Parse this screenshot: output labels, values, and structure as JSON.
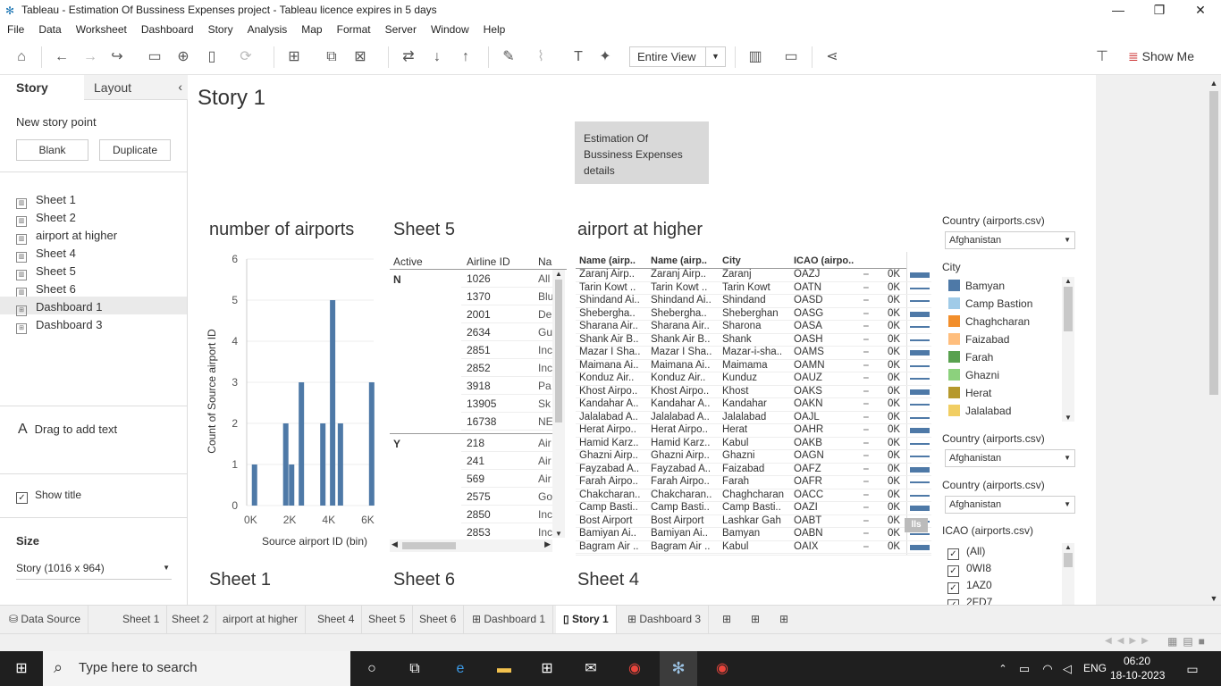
{
  "window": {
    "title": "Tableau - Estimation Of Bussiness Expenses  project - Tableau licence expires in 5 days"
  },
  "menu": [
    "File",
    "Data",
    "Worksheet",
    "Dashboard",
    "Story",
    "Analysis",
    "Map",
    "Format",
    "Server",
    "Window",
    "Help"
  ],
  "toolbar": {
    "view_select": "Entire View",
    "show_me": "Show Me"
  },
  "left": {
    "tab_story": "Story",
    "tab_layout": "Layout",
    "new_story_point": "New story point",
    "blank": "Blank",
    "duplicate": "Duplicate",
    "sheets": [
      "Sheet 1",
      "Sheet 2",
      "airport at higher",
      "Sheet 4",
      "Sheet 5",
      "Sheet 6",
      "Dashboard 1",
      "Dashboard 3"
    ],
    "drag_text": "Drag to add text",
    "show_title": "Show title",
    "size_label": "Size",
    "size_value": "Story (1016 x 964)"
  },
  "story": {
    "title": "Story 1",
    "caption": "Estimation Of Bussiness Expenses details",
    "sheet_titles": {
      "num_airports": "number of airports",
      "sheet5": "Sheet 5",
      "airport_higher": "airport at higher",
      "sheet1": "Sheet 1",
      "sheet6": "Sheet 6",
      "sheet4": "Sheet 4"
    }
  },
  "chart_data": {
    "type": "bar",
    "title": "number of airports",
    "xlabel": "Source airport ID (bin)",
    "ylabel": "Count of Source airport ID",
    "yticks": [
      "0",
      "1",
      "2",
      "3",
      "4",
      "5",
      "6"
    ],
    "xticks": [
      "0K",
      "2K",
      "4K",
      "6K"
    ],
    "ylim": [
      0,
      6
    ],
    "xlim": [
      -200,
      6300
    ],
    "x": [
      200,
      1800,
      2100,
      2600,
      3700,
      4200,
      4600,
      6200
    ],
    "values": [
      1,
      2,
      1,
      3,
      2,
      5,
      2,
      3
    ]
  },
  "sheet5": {
    "headers": [
      "Active",
      "Airline ID",
      "Na"
    ],
    "groups": [
      {
        "active": "N",
        "rows": [
          [
            "1026",
            "All"
          ],
          [
            "1370",
            "Blu"
          ],
          [
            "2001",
            "De"
          ],
          [
            "2634",
            "Gu"
          ],
          [
            "2851",
            "Inc"
          ],
          [
            "2852",
            "Inc"
          ],
          [
            "3918",
            "Pa"
          ],
          [
            "13905",
            "Sk"
          ],
          [
            "16738",
            "NE"
          ]
        ]
      },
      {
        "active": "Y",
        "rows": [
          [
            "218",
            "Air"
          ],
          [
            "241",
            "Air"
          ],
          [
            "569",
            "Air"
          ],
          [
            "2575",
            "Go"
          ],
          [
            "2850",
            "Inc"
          ],
          [
            "2853",
            "Inc"
          ]
        ]
      }
    ]
  },
  "airports": {
    "headers": [
      "Name (airp..",
      "Name (airp..",
      "City",
      "ICAO (airpo.."
    ],
    "status": "0K",
    "rows": [
      [
        "Zaranj Airp..",
        "Zaranj Airp..",
        "Zaranj",
        "OAZJ"
      ],
      [
        "Tarin Kowt ..",
        "Tarin Kowt ..",
        "Tarin Kowt",
        "OATN"
      ],
      [
        "Shindand Ai..",
        "Shindand Ai..",
        "Shindand",
        "OASD"
      ],
      [
        "Shebergha..",
        "Shebergha..",
        "Sheberghan",
        "OASG"
      ],
      [
        "Sharana Air..",
        "Sharana Air..",
        "Sharona",
        "OASA"
      ],
      [
        "Shank Air B..",
        "Shank Air B..",
        "Shank",
        "OASH"
      ],
      [
        "Mazar I Sha..",
        "Mazar I Sha..",
        "Mazar-i-sha..",
        "OAMS"
      ],
      [
        "Maimana Ai..",
        "Maimana Ai..",
        "Maimama",
        "OAMN"
      ],
      [
        "Konduz Air..",
        "Konduz Air..",
        "Kunduz",
        "OAUZ"
      ],
      [
        "Khost Airpo..",
        "Khost Airpo..",
        "Khost",
        "OAKS"
      ],
      [
        "Kandahar A..",
        "Kandahar A..",
        "Kandahar",
        "OAKN"
      ],
      [
        "Jalalabad A..",
        "Jalalabad A..",
        "Jalalabad",
        "OAJL"
      ],
      [
        "Herat Airpo..",
        "Herat Airpo..",
        "Herat",
        "OAHR"
      ],
      [
        "Hamid Karz..",
        "Hamid Karz..",
        "Kabul",
        "OAKB"
      ],
      [
        "Ghazni Airp..",
        "Ghazni Airp..",
        "Ghazni",
        "OAGN"
      ],
      [
        "Fayzabad A..",
        "Fayzabad A..",
        "Faizabad",
        "OAFZ"
      ],
      [
        "Farah Airpo..",
        "Farah Airpo..",
        "Farah",
        "OAFR"
      ],
      [
        "Chakcharan..",
        "Chakcharan..",
        "Chaghcharan",
        "OACC"
      ],
      [
        "Camp Basti..",
        "Camp Basti..",
        "Camp Basti..",
        "OAZI"
      ],
      [
        "Bost Airport",
        "Bost Airport",
        "Lashkar Gah",
        "OABT"
      ],
      [
        "Bamiyan Ai..",
        "Bamiyan Ai..",
        "Bamyan",
        "OABN"
      ],
      [
        "Bagram Air ..",
        "Bagram Air ..",
        "Kabul",
        "OAIX"
      ]
    ]
  },
  "filters": {
    "country_label": "Country (airports.csv)",
    "country_value": "Afghanistan",
    "city_label": "City",
    "cities": [
      {
        "name": "Bamyan",
        "color": "#4e79a7"
      },
      {
        "name": "Camp Bastion",
        "color": "#a0cbe8"
      },
      {
        "name": "Chaghcharan",
        "color": "#f28e2b"
      },
      {
        "name": "Faizabad",
        "color": "#ffbe7d"
      },
      {
        "name": "Farah",
        "color": "#59a14f"
      },
      {
        "name": "Ghazni",
        "color": "#8cd17d"
      },
      {
        "name": "Herat",
        "color": "#b6992d"
      },
      {
        "name": "Jalalabad",
        "color": "#f1ce63"
      }
    ],
    "icao_label": "ICAO (airports.csv)",
    "icao_items": [
      "(All)",
      "0WI8",
      "1AZ0",
      "2FD7"
    ]
  },
  "tabs": [
    "Data Source",
    "Sheet 1",
    "Sheet 2",
    "airport at higher",
    "Sheet 4",
    "Sheet 5",
    "Sheet 6",
    "Dashboard 1",
    "Story 1",
    "Dashboard 3"
  ],
  "taskbar": {
    "search_placeholder": "Type here to search",
    "time": "06:20",
    "date": "18-10-2023",
    "lang": "ENG"
  }
}
